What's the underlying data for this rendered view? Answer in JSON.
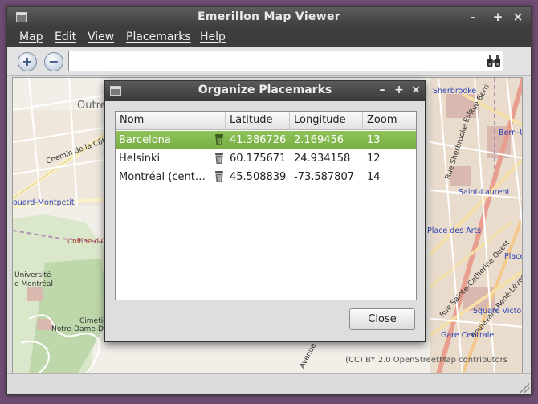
{
  "window": {
    "title": "Emerillon Map Viewer",
    "controls": [
      "–",
      "+",
      "×"
    ]
  },
  "menubar": {
    "items": [
      {
        "label": "Map"
      },
      {
        "label": "Edit"
      },
      {
        "label": "View"
      },
      {
        "label": "Placemarks"
      },
      {
        "label": "Help"
      }
    ]
  },
  "toolbar": {
    "zoom_in_icon": "zoom-in-icon",
    "zoom_out_icon": "zoom-out-icon",
    "search_value": "",
    "search_icon": "binoculars-icon"
  },
  "map": {
    "labels": {
      "outremont": "Outre",
      "chemin": "Chemin de la Côte",
      "montpetit": "ouard-Montpetit",
      "colline": "Colline d'O",
      "universite_1": "Université",
      "universite_2": "e Montréal",
      "cimetiere_1": "Cimetie",
      "cimetiere_2": "Notre-Dame-D",
      "sherbrooke": "Sherbrooke",
      "berri": "Rue Berri",
      "berri_uqam": "Berri-U",
      "rue_sherbrooke_est": "Rue Sherbrooke Est",
      "saint_laurent": "Saint-Laurent",
      "place_des_arts": "Place des Arts",
      "place": "Place",
      "rene_levesque": "Boulevard René-Lévesque Ouest",
      "sainte_catherine": "Rue Sainte-Catherine Ouest",
      "square_victoria": "Square Victor",
      "gare_centrale": "Gare Centrale",
      "avenue": "Avenue"
    },
    "credit": "(CC) BY 2.0 OpenStreetMap contributors"
  },
  "dialog": {
    "title": "Organize Placemarks",
    "controls": [
      "–",
      "+",
      "×"
    ],
    "columns": [
      "Nom",
      "Latitude",
      "Longitude",
      "Zoom"
    ],
    "rows": [
      {
        "name": "Barcelona",
        "latitude": "41.386726",
        "longitude": "2.169456",
        "zoom": "13",
        "selected": true
      },
      {
        "name": "Helsinki",
        "latitude": "60.175671",
        "longitude": "24.934158",
        "zoom": "12",
        "selected": false
      },
      {
        "name": "Montréal (cent…",
        "latitude": "45.508839",
        "longitude": "-73.587807",
        "zoom": "14",
        "selected": false
      }
    ],
    "close_label": "Close",
    "delete_icon": "trash-icon"
  },
  "colors": {
    "selection": "#7fb64c",
    "titlebar": "#3c3c3c",
    "desktop": "#6e4d72"
  }
}
